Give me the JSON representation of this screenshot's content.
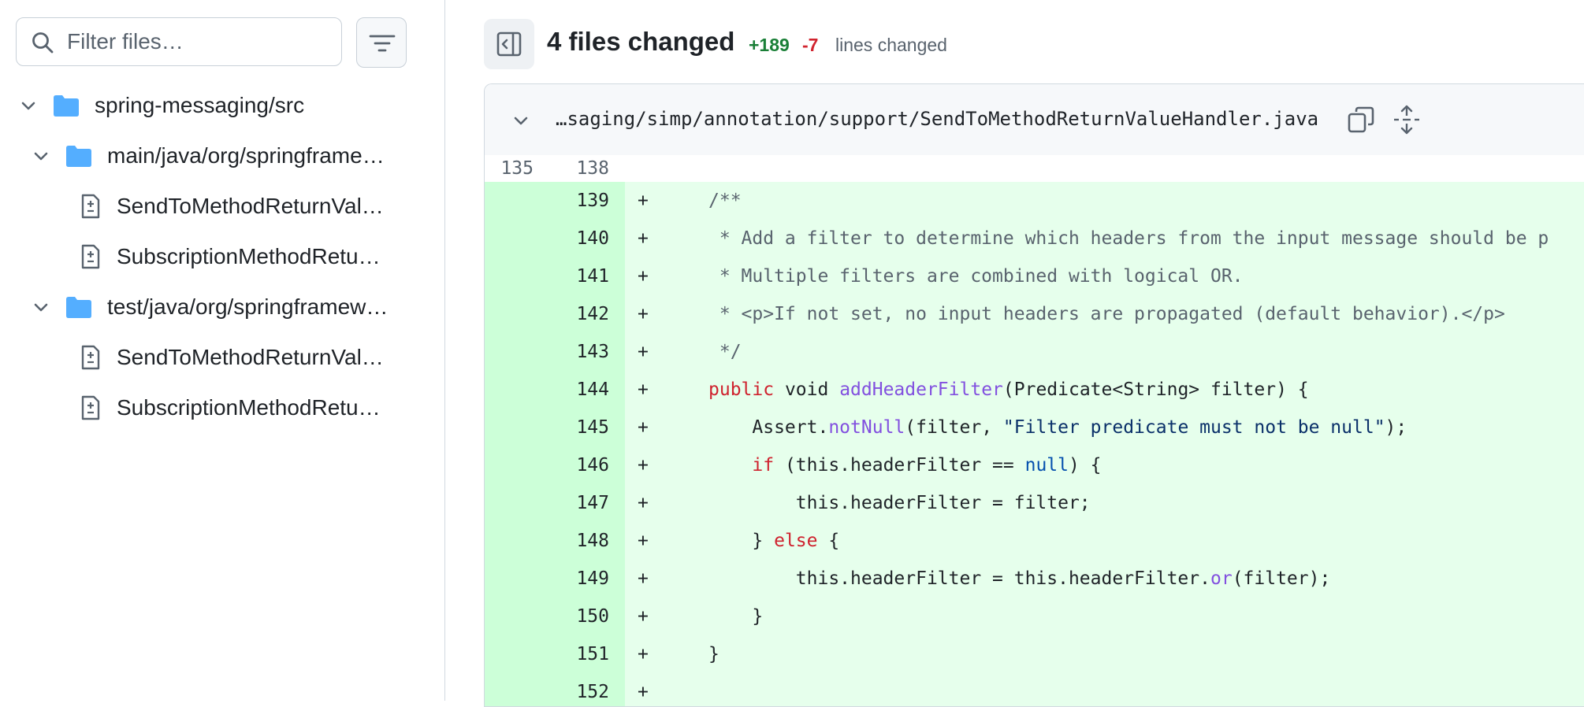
{
  "sidebar": {
    "filter": {
      "placeholder": "Filter files…",
      "value": ""
    },
    "tree": [
      {
        "label": "spring-messaging/src",
        "type": "folder",
        "level": 0
      },
      {
        "label": "main/java/org/springframe…",
        "type": "folder",
        "level": 1
      },
      {
        "label": "SendToMethodReturnVal…",
        "type": "file",
        "level": 2
      },
      {
        "label": "SubscriptionMethodRetu…",
        "type": "file",
        "level": 2
      },
      {
        "label": "test/java/org/springframew…",
        "type": "folder",
        "level": 1
      },
      {
        "label": "SendToMethodReturnVal…",
        "type": "file",
        "level": 2
      },
      {
        "label": "SubscriptionMethodRetu…",
        "type": "file",
        "level": 2
      }
    ]
  },
  "header": {
    "files_changed": "4 files changed",
    "additions": "+189",
    "deletions": "-7",
    "lines_changed_label": "lines changed"
  },
  "file": {
    "path": "…saging/simp/annotation/support/SendToMethodReturnValueHandler.java",
    "context_row": {
      "old": "135",
      "new": "138"
    },
    "lines": [
      {
        "new": "139",
        "sign": "+",
        "tokens": [
          {
            "t": "/**",
            "c": "com"
          }
        ]
      },
      {
        "new": "140",
        "sign": "+",
        "tokens": [
          {
            "t": " * Add a filter to determine which headers from the input message should be p",
            "c": "com"
          }
        ]
      },
      {
        "new": "141",
        "sign": "+",
        "tokens": [
          {
            "t": " * Multiple filters are combined with logical OR.",
            "c": "com"
          }
        ]
      },
      {
        "new": "142",
        "sign": "+",
        "tokens": [
          {
            "t": " * <p>If not set, no input headers are propagated (default behavior).</p>",
            "c": "com"
          }
        ]
      },
      {
        "new": "143",
        "sign": "+",
        "tokens": [
          {
            "t": " */",
            "c": "com"
          }
        ]
      },
      {
        "new": "144",
        "sign": "+",
        "tokens": [
          {
            "t": "public",
            "c": "kw"
          },
          {
            "t": " void ",
            "c": ""
          },
          {
            "t": "addHeaderFilter",
            "c": "fn"
          },
          {
            "t": "(Predicate<String> filter) {",
            "c": ""
          }
        ]
      },
      {
        "new": "145",
        "sign": "+",
        "tokens": [
          {
            "t": "    Assert.",
            "c": ""
          },
          {
            "t": "notNull",
            "c": "fn"
          },
          {
            "t": "(filter, ",
            "c": ""
          },
          {
            "t": "\"Filter predicate must not be null\"",
            "c": "str"
          },
          {
            "t": ");",
            "c": ""
          }
        ]
      },
      {
        "new": "146",
        "sign": "+",
        "tokens": [
          {
            "t": "    ",
            "c": ""
          },
          {
            "t": "if",
            "c": "kw"
          },
          {
            "t": " (this.headerFilter == ",
            "c": ""
          },
          {
            "t": "null",
            "c": "lit"
          },
          {
            "t": ") {",
            "c": ""
          }
        ]
      },
      {
        "new": "147",
        "sign": "+",
        "tokens": [
          {
            "t": "        this.headerFilter = filter;",
            "c": ""
          }
        ]
      },
      {
        "new": "148",
        "sign": "+",
        "tokens": [
          {
            "t": "    } ",
            "c": ""
          },
          {
            "t": "else",
            "c": "kw"
          },
          {
            "t": " {",
            "c": ""
          }
        ]
      },
      {
        "new": "149",
        "sign": "+",
        "tokens": [
          {
            "t": "        this.headerFilter = this.headerFilter.",
            "c": ""
          },
          {
            "t": "or",
            "c": "fn"
          },
          {
            "t": "(filter);",
            "c": ""
          }
        ]
      },
      {
        "new": "150",
        "sign": "+",
        "tokens": [
          {
            "t": "    }",
            "c": ""
          }
        ]
      },
      {
        "new": "151",
        "sign": "+",
        "tokens": [
          {
            "t": "}",
            "c": ""
          }
        ]
      },
      {
        "new": "152",
        "sign": "+",
        "tokens": []
      }
    ]
  },
  "colors": {
    "added_bg": "#e6ffec",
    "added_gutter_bg": "#ccffd8",
    "additions": "#1a7f37",
    "deletions": "#d1242f",
    "folder": "#54aeff"
  },
  "icons": [
    "search-icon",
    "filter-icon",
    "chevron-down-icon",
    "folder-icon",
    "file-diff-icon",
    "sidebar-collapse-icon",
    "copy-icon",
    "expand-icon"
  ]
}
